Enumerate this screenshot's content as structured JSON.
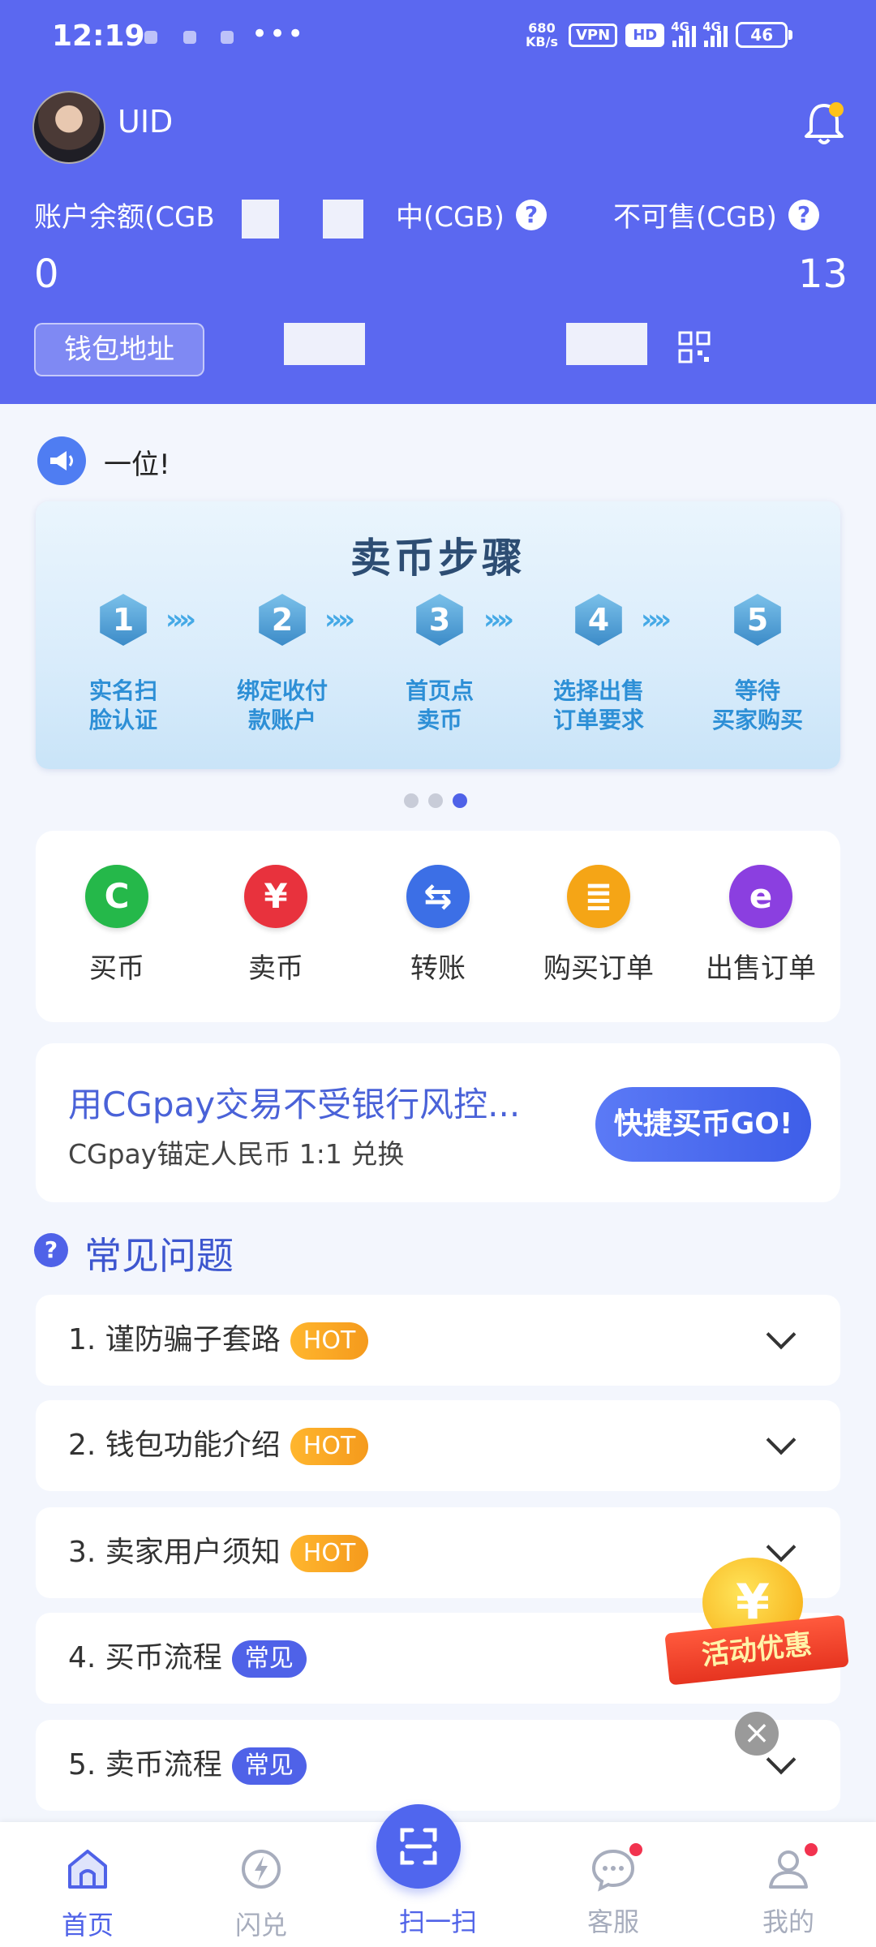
{
  "status_bar": {
    "time": "12:19",
    "more": "•••",
    "speed": "680 KB/s",
    "vpn": "VPN",
    "hd": "HD",
    "net1": "4G",
    "net2": "4G",
    "battery": "46"
  },
  "header": {
    "uid_label": "UID",
    "balance_label": "账户余额(CGB",
    "trading_label": "中(CGB)",
    "unsellable_label": "不可售(CGB)",
    "balance_value": "0",
    "unsellable_value": "13",
    "wallet_button": "钱包地址"
  },
  "notice": {
    "text": "一位!"
  },
  "banner": {
    "title": "卖币步骤",
    "steps": [
      {
        "num": "1",
        "text": "实名扫\n脸认证"
      },
      {
        "num": "2",
        "text": "绑定收付\n款账户"
      },
      {
        "num": "3",
        "text": "首页点\n卖币"
      },
      {
        "num": "4",
        "text": "选择出售\n订单要求"
      },
      {
        "num": "5",
        "text": "等待\n买家购买"
      }
    ],
    "arrow": "››››"
  },
  "actions": [
    {
      "label": "买币",
      "glyph": "C",
      "color": "#25b84a"
    },
    {
      "label": "卖币",
      "glyph": "¥",
      "color": "#e8323d"
    },
    {
      "label": "转账",
      "glyph": "⇆",
      "color": "#3c6fe6"
    },
    {
      "label": "购买订单",
      "glyph": "≣",
      "color": "#f5a516"
    },
    {
      "label": "出售订单",
      "glyph": "e",
      "color": "#8b3fe0"
    }
  ],
  "promo": {
    "title": "用CGpay交易不受银行风控...",
    "subtitle": "CGpay锚定人民币 1:1 兑换",
    "button": "快捷买币GO!"
  },
  "faq": {
    "title": "常见问题",
    "items": [
      {
        "label": "1.  谨防骗子套路",
        "badge": "HOT",
        "type": "hot"
      },
      {
        "label": "2.  钱包功能介绍",
        "badge": "HOT",
        "type": "hot"
      },
      {
        "label": "3.  卖家用户须知",
        "badge": "HOT",
        "type": "hot"
      },
      {
        "label": "4.  买币流程",
        "badge": "常见",
        "type": "common"
      },
      {
        "label": "5.  卖币流程",
        "badge": "常见",
        "type": "common"
      }
    ]
  },
  "float_promo": {
    "coin": "¥",
    "text": "活动优惠",
    "close": "×"
  },
  "bottom_nav": [
    {
      "label": "首页",
      "active": true
    },
    {
      "label": "闪兑",
      "active": false
    },
    {
      "label": "扫一扫",
      "active": true
    },
    {
      "label": "客服",
      "active": false
    },
    {
      "label": "我的",
      "active": false
    }
  ]
}
